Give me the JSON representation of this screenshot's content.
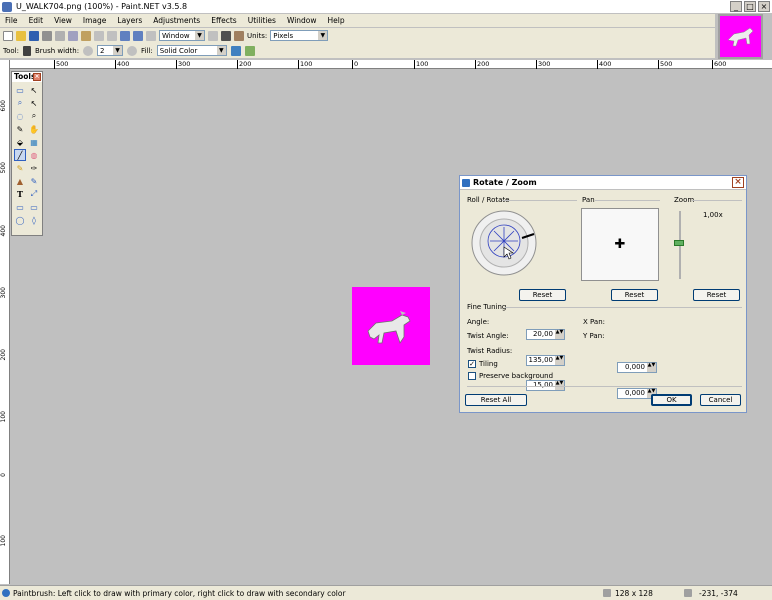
{
  "window": {
    "title": "U_WALK704.png (100%) - Paint.NET v3.5.8",
    "min": "_",
    "max": "□",
    "close": "×"
  },
  "menu": [
    "File",
    "Edit",
    "View",
    "Image",
    "Layers",
    "Adjustments",
    "Effects",
    "Utilities",
    "Window",
    "Help"
  ],
  "toolbar": {
    "zoom_select": "Window",
    "units_label": "Units:",
    "units_value": "Pixels"
  },
  "toolbar2": {
    "tool_label": "Tool:",
    "brush_width_label": "Brush width:",
    "brush_width_value": "2",
    "fill_label": "Fill:",
    "fill_value": "Solid Color"
  },
  "ruler_top_labels": [
    "500",
    "400",
    "300",
    "200",
    "100",
    "0",
    "100",
    "200",
    "300",
    "400",
    "500",
    "600"
  ],
  "ruler_left_labels": [
    "600",
    "500",
    "400",
    "300",
    "200",
    "100",
    "0",
    "100",
    "200",
    "300",
    "400",
    "500"
  ],
  "tools_panel": {
    "title": "Tools",
    "close": "×",
    "glyphs": [
      "▭",
      "↖",
      "⌕",
      "↖",
      "◌",
      "⌕",
      "✎",
      "✋",
      "⬙",
      "▦",
      "╱",
      "◍",
      "✎",
      "✑",
      "▲",
      "✎",
      "T",
      "⤢",
      "▭",
      "▭",
      "◯",
      "◊"
    ]
  },
  "dialog": {
    "title": "Rotate / Zoom",
    "close": "×",
    "roll_rotate": "Roll / Rotate",
    "pan": "Pan",
    "zoom": "Zoom",
    "zoom_value": "1,00x",
    "pan_glyph": "✚",
    "reset": "Reset",
    "fine_tuning": "Fine Tuning",
    "angle_label": "Angle:",
    "angle_value": "20,00",
    "twist_angle_label": "Twist Angle:",
    "twist_angle_value": "135,00",
    "twist_radius_label": "Twist Radius:",
    "twist_radius_value": "15,00",
    "xpan_label": "X Pan:",
    "xpan_value": "0,000",
    "ypan_label": "Y Pan:",
    "ypan_value": "0,000",
    "tiling_label": "Tiling",
    "tiling_checked": true,
    "tiling_mark": "✓",
    "preserve_label": "Preserve background",
    "preserve_checked": false,
    "reset_all": "Reset All",
    "ok": "OK",
    "cancel": "Cancel"
  },
  "status": {
    "hint": "Paintbrush: Left click to draw with primary color, right click to draw with secondary color",
    "size": "128 x 128",
    "coords": "-231, -374"
  },
  "colors": {
    "canvas_bg": "#c0c0c0",
    "image_bg": "#ff00ff"
  }
}
